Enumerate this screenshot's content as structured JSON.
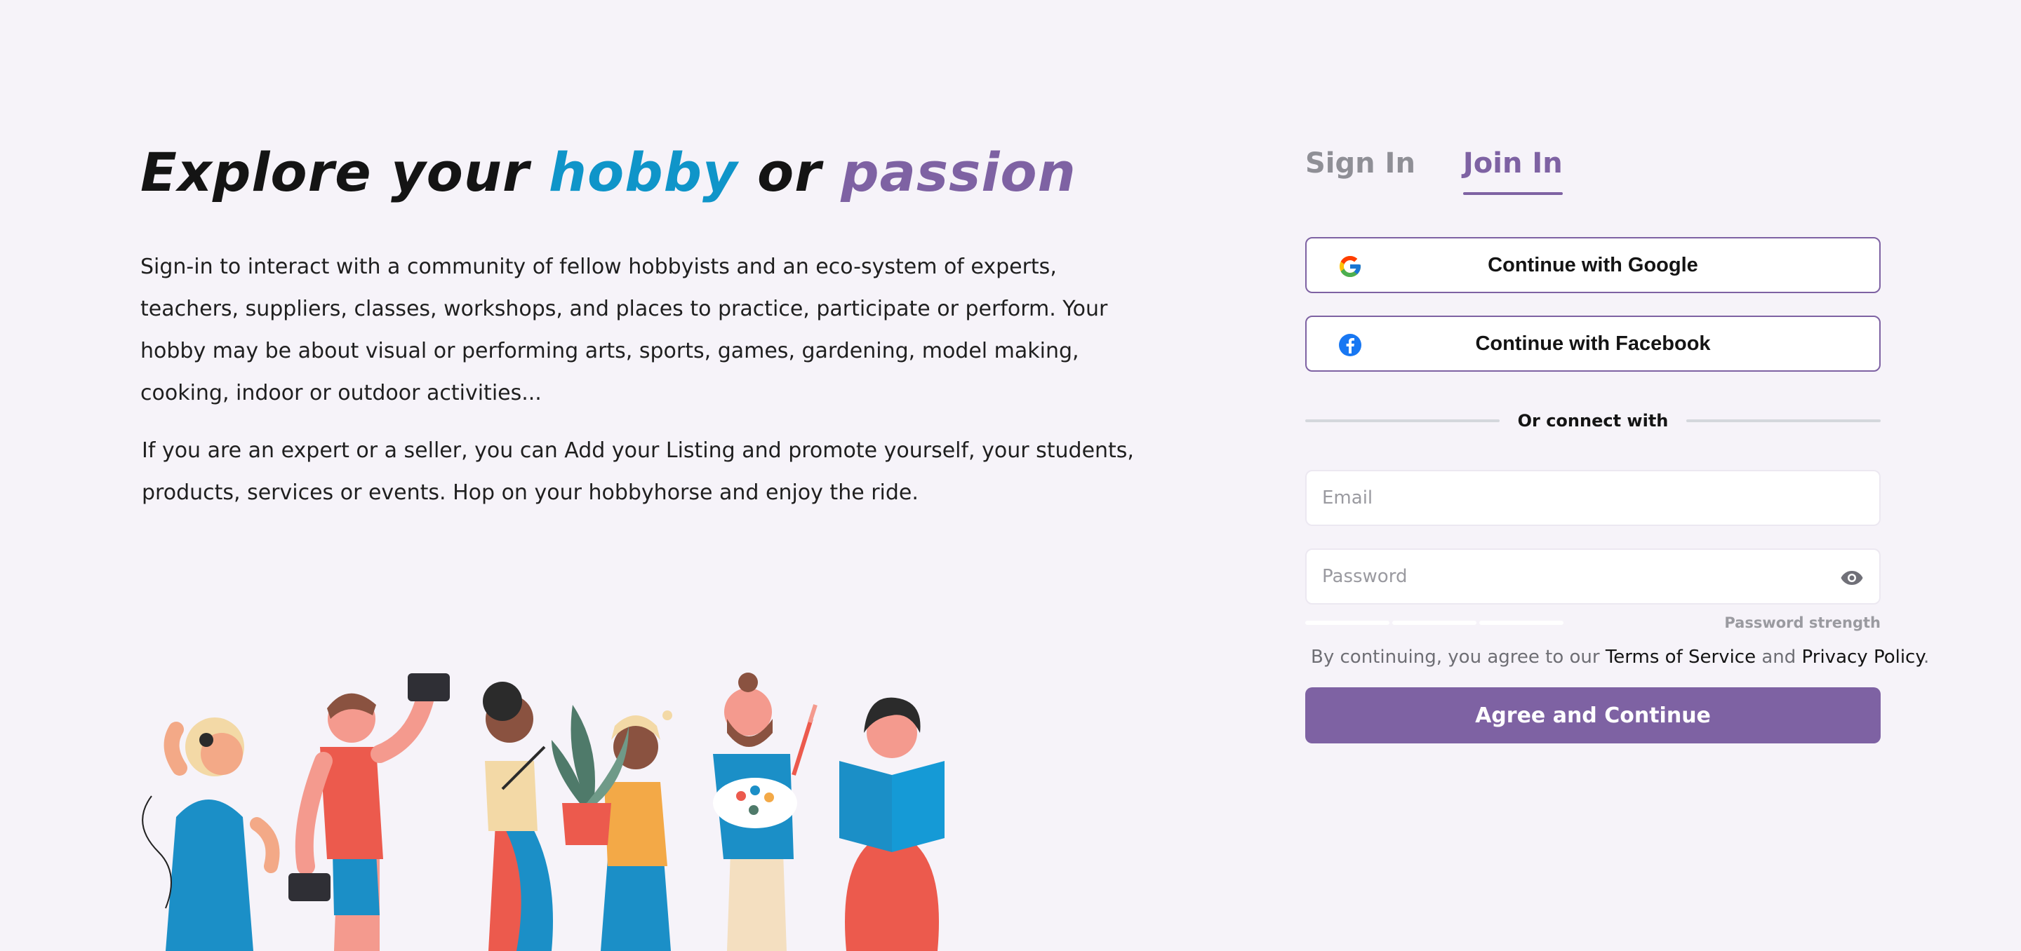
{
  "hero": {
    "title_part1": "Explore your ",
    "title_hobby": "hobby",
    "title_part2": " or ",
    "title_passion": "passion",
    "paragraph1": "Sign-in to interact with a community of fellow hobbyists and an eco-system of experts, teachers, suppliers, classes, workshops, and places to practice, participate or perform. Your hobby may be about visual or performing arts, sports, games, gardening, model making, cooking, indoor or outdoor activities...",
    "paragraph2": "If you are an expert or a seller, you can Add your Listing and promote yourself, your students, products,  services or events.  Hop on your hobbyhorse and enjoy the ride."
  },
  "illustration": {
    "icon": "hobbyists-illustration"
  },
  "auth": {
    "tabs": [
      {
        "label": "Sign In",
        "active": false
      },
      {
        "label": "Join In",
        "active": true
      }
    ],
    "google_label": "Continue with Google",
    "facebook_label": "Continue with Facebook",
    "divider_text": "Or connect with",
    "email_placeholder": "Email",
    "password_placeholder": "Password",
    "password_strength_label": "Password strength",
    "terms_prefix": "By continuing, you agree to our ",
    "terms_link": "Terms of Service",
    "terms_and": " and ",
    "privacy_link": "Privacy Policy",
    "terms_suffix": ".",
    "submit_label": "Agree and Continue"
  },
  "colors": {
    "background": "#f6f3f9",
    "accent_purple": "#7e62a3",
    "accent_blue": "#0f95c9"
  }
}
